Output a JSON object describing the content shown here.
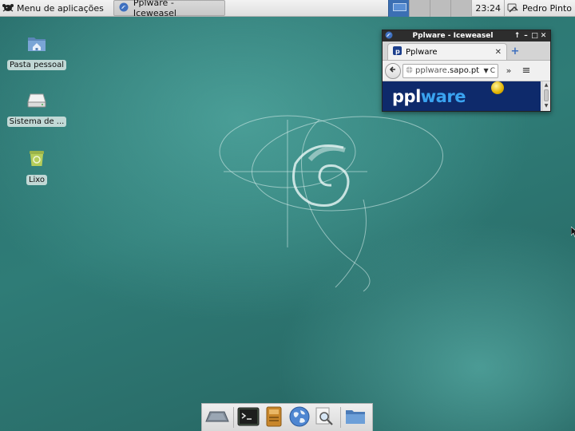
{
  "top_panel": {
    "app_menu_label": "Menu de aplicações",
    "app_menu_icon": "debian-mouse-icon",
    "task_label": "Pplware - Iceweasel",
    "task_icon": "iceweasel-icon",
    "workspaces": {
      "count": 4,
      "active_index": 0
    },
    "clock": "23:24",
    "tray_icon": "network-icon",
    "user_name": "Pedro Pinto"
  },
  "desktop_icons": [
    {
      "label": "Pasta pessoal",
      "icon": "home-folder-icon"
    },
    {
      "label": "Sistema de ...",
      "icon": "drive-icon"
    },
    {
      "label": "Lixo",
      "icon": "trash-icon"
    }
  ],
  "browser": {
    "window_title": "Pplware - Iceweasel",
    "window_controls": [
      "↑",
      "–",
      "□",
      "✕"
    ],
    "tab_title": "Pplware",
    "tab_close": "✕",
    "new_tab": "+",
    "url_host": "pplware",
    "url_domain": ".sapo.pt",
    "url_dropdown": "▼",
    "reload": "C",
    "overflow": "»",
    "menu": "≡",
    "banner_text_a": "ppl",
    "banner_text_b": "ware"
  },
  "dock": {
    "items": [
      "desktop-icon",
      "terminal-icon",
      "file-manager-icon",
      "web-browser-icon",
      "search-icon",
      "folder-icon"
    ]
  },
  "colors": {
    "desktop_teal": "#2f7c77",
    "workspace_active": "#3b6fb3",
    "banner_navy": "#0e2a6b",
    "banner_accent": "#3aa3f0"
  }
}
